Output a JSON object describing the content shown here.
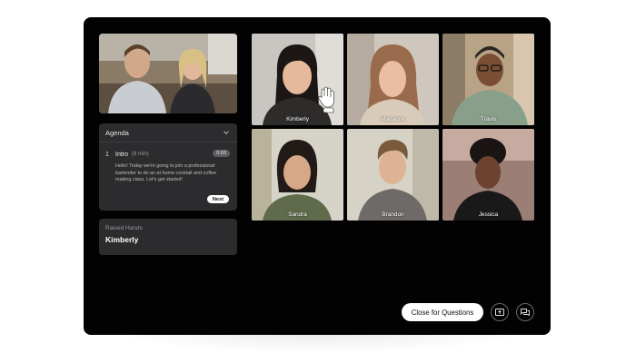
{
  "agenda": {
    "title": "Agenda",
    "item": {
      "number": "1",
      "name": "Intro",
      "duration": "(8 min)",
      "timer": "0:03",
      "description": "Hello! Today we're going to join a professional bartender to do an at home cocktail and coffee making class. Let's get started!",
      "next_label": "Next"
    }
  },
  "raised_hands": {
    "label": "Raised Hands",
    "name": "Kimberly"
  },
  "participants": [
    {
      "name": "Kimberly"
    },
    {
      "name": "Marianne"
    },
    {
      "name": "Travis"
    },
    {
      "name": "Sandra"
    },
    {
      "name": "Brandon"
    },
    {
      "name": "Jessica"
    }
  ],
  "controls": {
    "close_questions_label": "Close for Questions",
    "present_icon": "present-screen-icon",
    "chat_icon": "chat-icon"
  },
  "colors": {
    "device_bg": "#020202",
    "panel_bg": "#2c2c2e",
    "button_bg": "#ffffff"
  }
}
